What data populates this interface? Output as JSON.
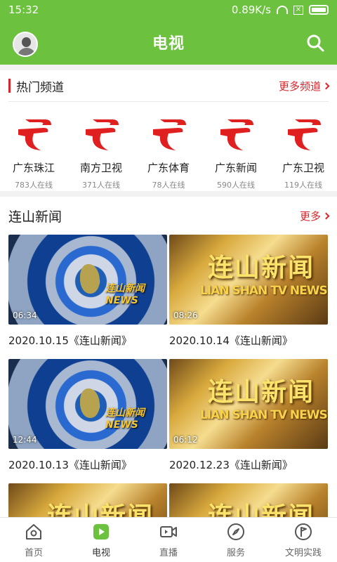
{
  "status": {
    "time": "15:32",
    "speed": "0.89K/s"
  },
  "header": {
    "title": "电视"
  },
  "hot_channels": {
    "title": "热门频道",
    "more": "更多频道",
    "items": [
      {
        "name": "广东珠江",
        "online": "783人在线"
      },
      {
        "name": "南方卫视",
        "online": "371人在线"
      },
      {
        "name": "广东体育",
        "online": "78人在线"
      },
      {
        "name": "广东新闻",
        "online": "590人在线"
      },
      {
        "name": "广东卫视",
        "online": "119人在线"
      }
    ]
  },
  "news": {
    "title": "连山新闻",
    "more": "更多",
    "thumb_text": {
      "title": "连山新闻",
      "subtitle": "LIAN SHAN TV NEWS",
      "small_cn": "连山新闻",
      "small_en": "NEWS"
    },
    "videos": [
      {
        "duration": "06:34",
        "caption": "2020.10.15《连山新闻》",
        "style": "blue"
      },
      {
        "duration": "08:26",
        "caption": "2020.10.14《连山新闻》",
        "style": "gold"
      },
      {
        "duration": "12:44",
        "caption": "2020.10.13《连山新闻》",
        "style": "blue"
      },
      {
        "duration": "06:12",
        "caption": "2020.12.23《连山新闻》",
        "style": "gold"
      }
    ]
  },
  "tabs": [
    {
      "label": "首页",
      "icon": "home-icon"
    },
    {
      "label": "电视",
      "icon": "tv-play-icon",
      "active": true
    },
    {
      "label": "直播",
      "icon": "video-camera-icon"
    },
    {
      "label": "服务",
      "icon": "compass-icon"
    },
    {
      "label": "文明实践",
      "icon": "flag-icon"
    }
  ],
  "colors": {
    "primary": "#6cc23f",
    "accent": "#d8262c"
  }
}
